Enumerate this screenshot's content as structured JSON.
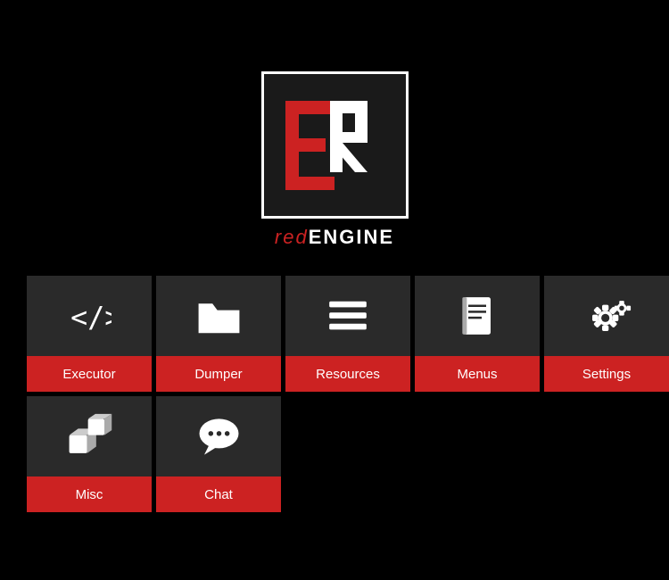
{
  "app": {
    "title": "redENGINE",
    "logo_text_red": "red",
    "logo_text_white": "ENGINE"
  },
  "grid": {
    "rows": [
      [
        {
          "id": "executor",
          "label": "Executor",
          "icon": "code"
        },
        {
          "id": "dumper",
          "label": "Dumper",
          "icon": "folder"
        },
        {
          "id": "resources",
          "label": "Resources",
          "icon": "list"
        },
        {
          "id": "menus",
          "label": "Menus",
          "icon": "book"
        },
        {
          "id": "settings",
          "label": "Settings",
          "icon": "gear"
        }
      ],
      [
        {
          "id": "misc",
          "label": "Misc",
          "icon": "cubes"
        },
        {
          "id": "chat",
          "label": "Chat",
          "icon": "chat"
        }
      ]
    ]
  }
}
